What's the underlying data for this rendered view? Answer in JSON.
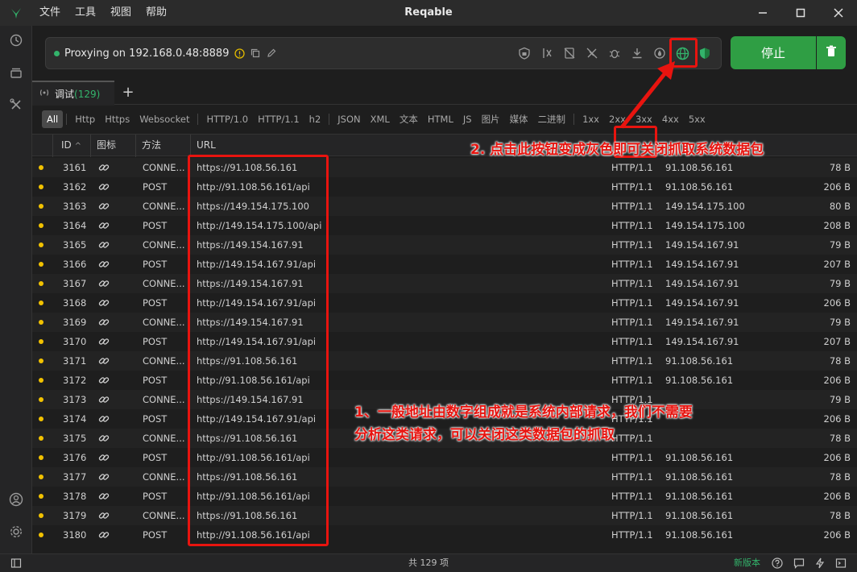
{
  "window": {
    "title": "Reqable",
    "menu": [
      "文件",
      "工具",
      "视图",
      "帮助"
    ]
  },
  "proxy": {
    "status_text": "Proxying on 192.168.0.48:8889",
    "stop_label": "停止"
  },
  "tabs": [
    {
      "label": "调试",
      "count": "(129)"
    }
  ],
  "filters": [
    "All",
    "Http",
    "Https",
    "Websocket",
    "HTTP/1.0",
    "HTTP/1.1",
    "h2",
    "JSON",
    "XML",
    "文本",
    "HTML",
    "JS",
    "图片",
    "媒体",
    "二进制",
    "1xx",
    "2xx",
    "3xx",
    "4xx",
    "5xx"
  ],
  "active_filter": "All",
  "table": {
    "headers": {
      "id": "ID",
      "icon": "图标",
      "method": "方法",
      "url": "URL"
    },
    "sort_indicator": "^",
    "rows": [
      {
        "id": "3161",
        "method": "CONNE...",
        "url": "https://91.108.56.161",
        "protocol": "HTTP/1.1",
        "ip": "91.108.56.161",
        "size": "78 B"
      },
      {
        "id": "3162",
        "method": "POST",
        "url": "http://91.108.56.161/api",
        "protocol": "HTTP/1.1",
        "ip": "91.108.56.161",
        "size": "206 B"
      },
      {
        "id": "3163",
        "method": "CONNE...",
        "url": "https://149.154.175.100",
        "protocol": "HTTP/1.1",
        "ip": "149.154.175.100",
        "size": "80 B"
      },
      {
        "id": "3164",
        "method": "POST",
        "url": "http://149.154.175.100/api",
        "protocol": "HTTP/1.1",
        "ip": "149.154.175.100",
        "size": "208 B"
      },
      {
        "id": "3165",
        "method": "CONNE...",
        "url": "https://149.154.167.91",
        "protocol": "HTTP/1.1",
        "ip": "149.154.167.91",
        "size": "79 B"
      },
      {
        "id": "3166",
        "method": "POST",
        "url": "http://149.154.167.91/api",
        "protocol": "HTTP/1.1",
        "ip": "149.154.167.91",
        "size": "207 B"
      },
      {
        "id": "3167",
        "method": "CONNE...",
        "url": "https://149.154.167.91",
        "protocol": "HTTP/1.1",
        "ip": "149.154.167.91",
        "size": "79 B"
      },
      {
        "id": "3168",
        "method": "POST",
        "url": "http://149.154.167.91/api",
        "protocol": "HTTP/1.1",
        "ip": "149.154.167.91",
        "size": "206 B"
      },
      {
        "id": "3169",
        "method": "CONNE...",
        "url": "https://149.154.167.91",
        "protocol": "HTTP/1.1",
        "ip": "149.154.167.91",
        "size": "79 B"
      },
      {
        "id": "3170",
        "method": "POST",
        "url": "http://149.154.167.91/api",
        "protocol": "HTTP/1.1",
        "ip": "149.154.167.91",
        "size": "207 B"
      },
      {
        "id": "3171",
        "method": "CONNE...",
        "url": "https://91.108.56.161",
        "protocol": "HTTP/1.1",
        "ip": "91.108.56.161",
        "size": "78 B"
      },
      {
        "id": "3172",
        "method": "POST",
        "url": "http://91.108.56.161/api",
        "protocol": "HTTP/1.1",
        "ip": "91.108.56.161",
        "size": "206 B"
      },
      {
        "id": "3173",
        "method": "CONNE...",
        "url": "https://149.154.167.91",
        "protocol": "HTTP/1.1",
        "ip": "",
        "size": "79 B"
      },
      {
        "id": "3174",
        "method": "POST",
        "url": "http://149.154.167.91/api",
        "protocol": "HTTP/1.1",
        "ip": "",
        "size": "206 B"
      },
      {
        "id": "3175",
        "method": "CONNE...",
        "url": "https://91.108.56.161",
        "protocol": "HTTP/1.1",
        "ip": "",
        "size": "78 B"
      },
      {
        "id": "3176",
        "method": "POST",
        "url": "http://91.108.56.161/api",
        "protocol": "HTTP/1.1",
        "ip": "91.108.56.161",
        "size": "206 B"
      },
      {
        "id": "3177",
        "method": "CONNE...",
        "url": "https://91.108.56.161",
        "protocol": "HTTP/1.1",
        "ip": "91.108.56.161",
        "size": "78 B"
      },
      {
        "id": "3178",
        "method": "POST",
        "url": "http://91.108.56.161/api",
        "protocol": "HTTP/1.1",
        "ip": "91.108.56.161",
        "size": "206 B"
      },
      {
        "id": "3179",
        "method": "CONNE...",
        "url": "https://91.108.56.161",
        "protocol": "HTTP/1.1",
        "ip": "91.108.56.161",
        "size": "78 B"
      },
      {
        "id": "3180",
        "method": "POST",
        "url": "http://91.108.56.161/api",
        "protocol": "HTTP/1.1",
        "ip": "91.108.56.161",
        "size": "206 B"
      }
    ]
  },
  "annotations": {
    "note2": "2. 点击此按钮变成灰色即可关闭抓取系统数据包",
    "note1_line1": "1、一般地址由数字组成就是系统内部请求，我们不需要",
    "note1_line2": "分析这类请求，可以关闭这类数据包的抓取"
  },
  "statusbar": {
    "count": "共 129 项",
    "new_version": "新版本"
  },
  "colors": {
    "accent_green": "#2f9e44",
    "status_dot_yellow": "#f2c200",
    "annotation_red": "#e8140f"
  },
  "icons": [
    "app-logo-icon",
    "history-icon",
    "layers-icon",
    "tools-icon",
    "user-icon",
    "settings-icon",
    "copy-icon",
    "edit-icon",
    "warning-icon",
    "globe-icon",
    "shield-icon",
    "trash-icon",
    "link-icon",
    "signal-icon"
  ]
}
